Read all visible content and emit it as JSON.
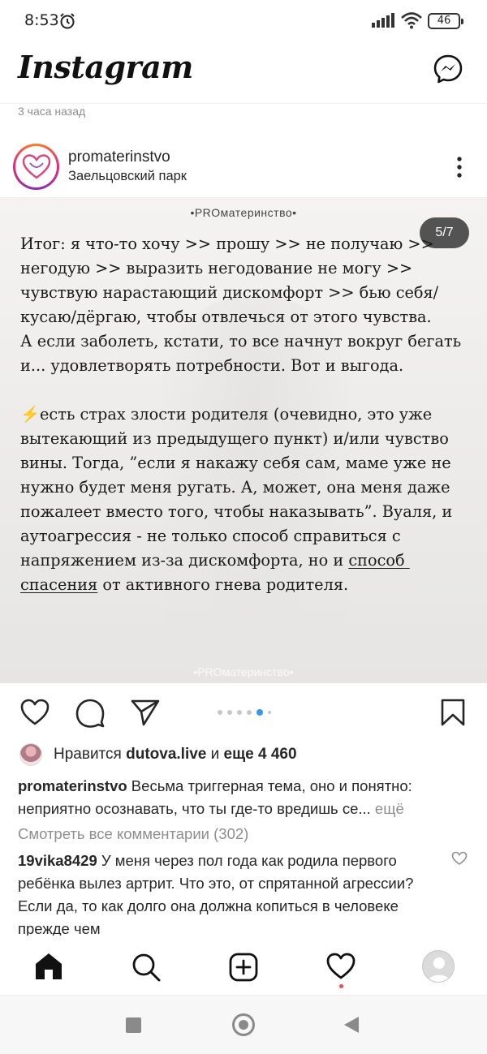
{
  "status_bar": {
    "time": "8:53",
    "battery": "46"
  },
  "header": {
    "logo": "Instagram"
  },
  "post": {
    "time_ago": "3 часа назад",
    "username": "promaterinstvo",
    "location": "Заельцовский парк",
    "image": {
      "brand_top": "•PROматеринство•",
      "brand_bottom": "•PROматеринство•",
      "slide_counter": "5/7",
      "text_part1": "Итог: я что-то хочу >> прошу >> не получаю >> негодую >> выразить негодование не могу >> чувствую нарастающий дискомфорт >> бью себя/кусаю/дёргаю, чтобы отвлечься от этого чувства.\nА если заболеть, кстати, то все начнут вокруг бегать и... удовлетворять потребности. Вот и выгода.\n\n",
      "bolt": "⚡",
      "text_part2": "есть страх злости родителя (очевидно, это уже вытекающий из предыдущего пункт) и/или чувство вины. Тогда, ”если я накажу себя сам, маме уже не нужно будет меня ругать. А, может, она меня даже пожалеет вместо того, чтобы наказывать”. Вуаля, и аутоагрессия - не только способ справиться с напряжением из-за дискомфорта, но и ",
      "text_underlined": "способ спасения",
      "text_part3": " от активного гнева родителя."
    },
    "carousel": {
      "count": 6,
      "active_index": 4
    },
    "likes": {
      "prefix": "Нравится ",
      "liker": "dutova.live",
      "middle": " и ",
      "others": "еще 4 460"
    },
    "caption": {
      "username": "promaterinstvo",
      "text": " Весьма триггерная тема, оно и понятно: неприятно осознавать, что ты где-то вредишь се...",
      "more": " ещё"
    },
    "view_comments": "Смотреть все комментарии (302)",
    "comment": {
      "username": "19vika8429",
      "text": " У меня через пол года как родила первого ребёнка вылез артрит. Что это, от спрятанной агрессии? Если да, то как долго она должна копиться в человеке прежде чем"
    }
  },
  "icons": {
    "accent": "#3897f0",
    "notification_dot": "#ed4956"
  }
}
